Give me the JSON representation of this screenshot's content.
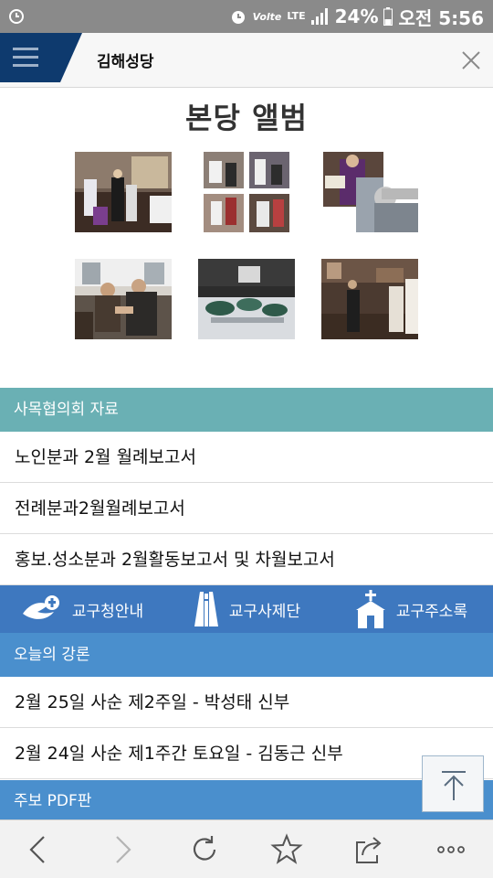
{
  "status_bar": {
    "carrier": "Volte",
    "network": "LTE",
    "battery": "24%",
    "time": "오전 5:56",
    "icons": [
      "alarm-icon",
      "signal-icon",
      "battery-icon"
    ]
  },
  "header": {
    "title": "김해성당",
    "menu_icon": "hamburger-icon",
    "close_icon": "close-icon"
  },
  "album": {
    "title": "본당 앨범",
    "photos": [
      {
        "subject": "altar-ceremony"
      },
      {
        "subject": "collage-four-photos"
      },
      {
        "subject": "priest-reading"
      },
      {
        "subject": "elderly-handshake"
      },
      {
        "subject": "table-display"
      },
      {
        "subject": "church-hall"
      }
    ]
  },
  "pastoral_council": {
    "header": "사목협의회 자료",
    "color": "#6ab0b4",
    "items": [
      "노인분과 2월 월례보고서",
      "전례분과2월월례보고서",
      "홍보.성소분과 2월활동보고서 및 차월보고서"
    ]
  },
  "quick_links": {
    "color": "#3e78bf",
    "items": [
      {
        "label": "교구청안내",
        "icon": "dove-cross-icon"
      },
      {
        "label": "교구사제단",
        "icon": "priest-robe-icon"
      },
      {
        "label": "교구주소록",
        "icon": "church-icon"
      }
    ]
  },
  "homily": {
    "header": "오늘의 강론",
    "color": "#4a8fcd",
    "items": [
      "2월 25일 사순 제2주일 - 박성태 신부",
      "2월 24일 사순 제1주간 토요일 - 김동근 신부"
    ]
  },
  "bulletin": {
    "header": "주보 PDF판",
    "color": "#4a8fcd"
  },
  "bottom_nav": {
    "icons": [
      "back-icon",
      "forward-icon",
      "reload-icon",
      "bookmark-star-icon",
      "share-icon",
      "more-icon"
    ]
  }
}
